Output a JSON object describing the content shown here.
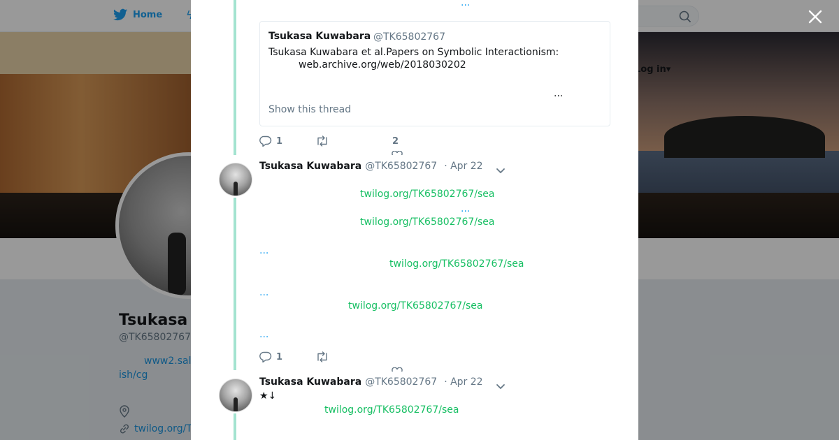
{
  "nav": {
    "home_label": "Home",
    "login_label": "Log in"
  },
  "profile": {
    "name": "Tsukasa",
    "handle": "@TK65802767",
    "bio_line1": "www2.sal",
    "bio_line2": "ish/cg",
    "link": "twilog.org/T"
  },
  "thread": {
    "top_ellipsis": "...",
    "quote": {
      "name": "Tsukasa Kuwabara",
      "handle": "@TK65802767",
      "text": "Tsukasa Kuwabara et al.Papers on Symbolic Interactionism:",
      "url": "web.archive.org/web/2018030202",
      "ellipsis": "...",
      "show_thread": "Show this thread"
    },
    "actions1": {
      "replies": "1",
      "likes": "2"
    },
    "tweet2": {
      "name": "Tsukasa Kuwabara",
      "handle": "@TK65802767",
      "date": "· Apr 22",
      "links": [
        "twilog.org/TK65802767/sea",
        "twilog.org/TK65802767/sea",
        "twilog.org/TK65802767/sea",
        "twilog.org/TK65802767/sea"
      ],
      "ellipsis": "..."
    },
    "actions2": {
      "replies": "1"
    },
    "tweet3": {
      "name": "Tsukasa Kuwabara",
      "handle": "@TK65802767",
      "date": "· Apr 22",
      "text": "★↓",
      "link": "twilog.org/TK65802767/sea"
    }
  },
  "colors": {
    "accent": "#1da1f2",
    "link_green": "#17bf63",
    "thread_line": "#a3e3d0"
  }
}
